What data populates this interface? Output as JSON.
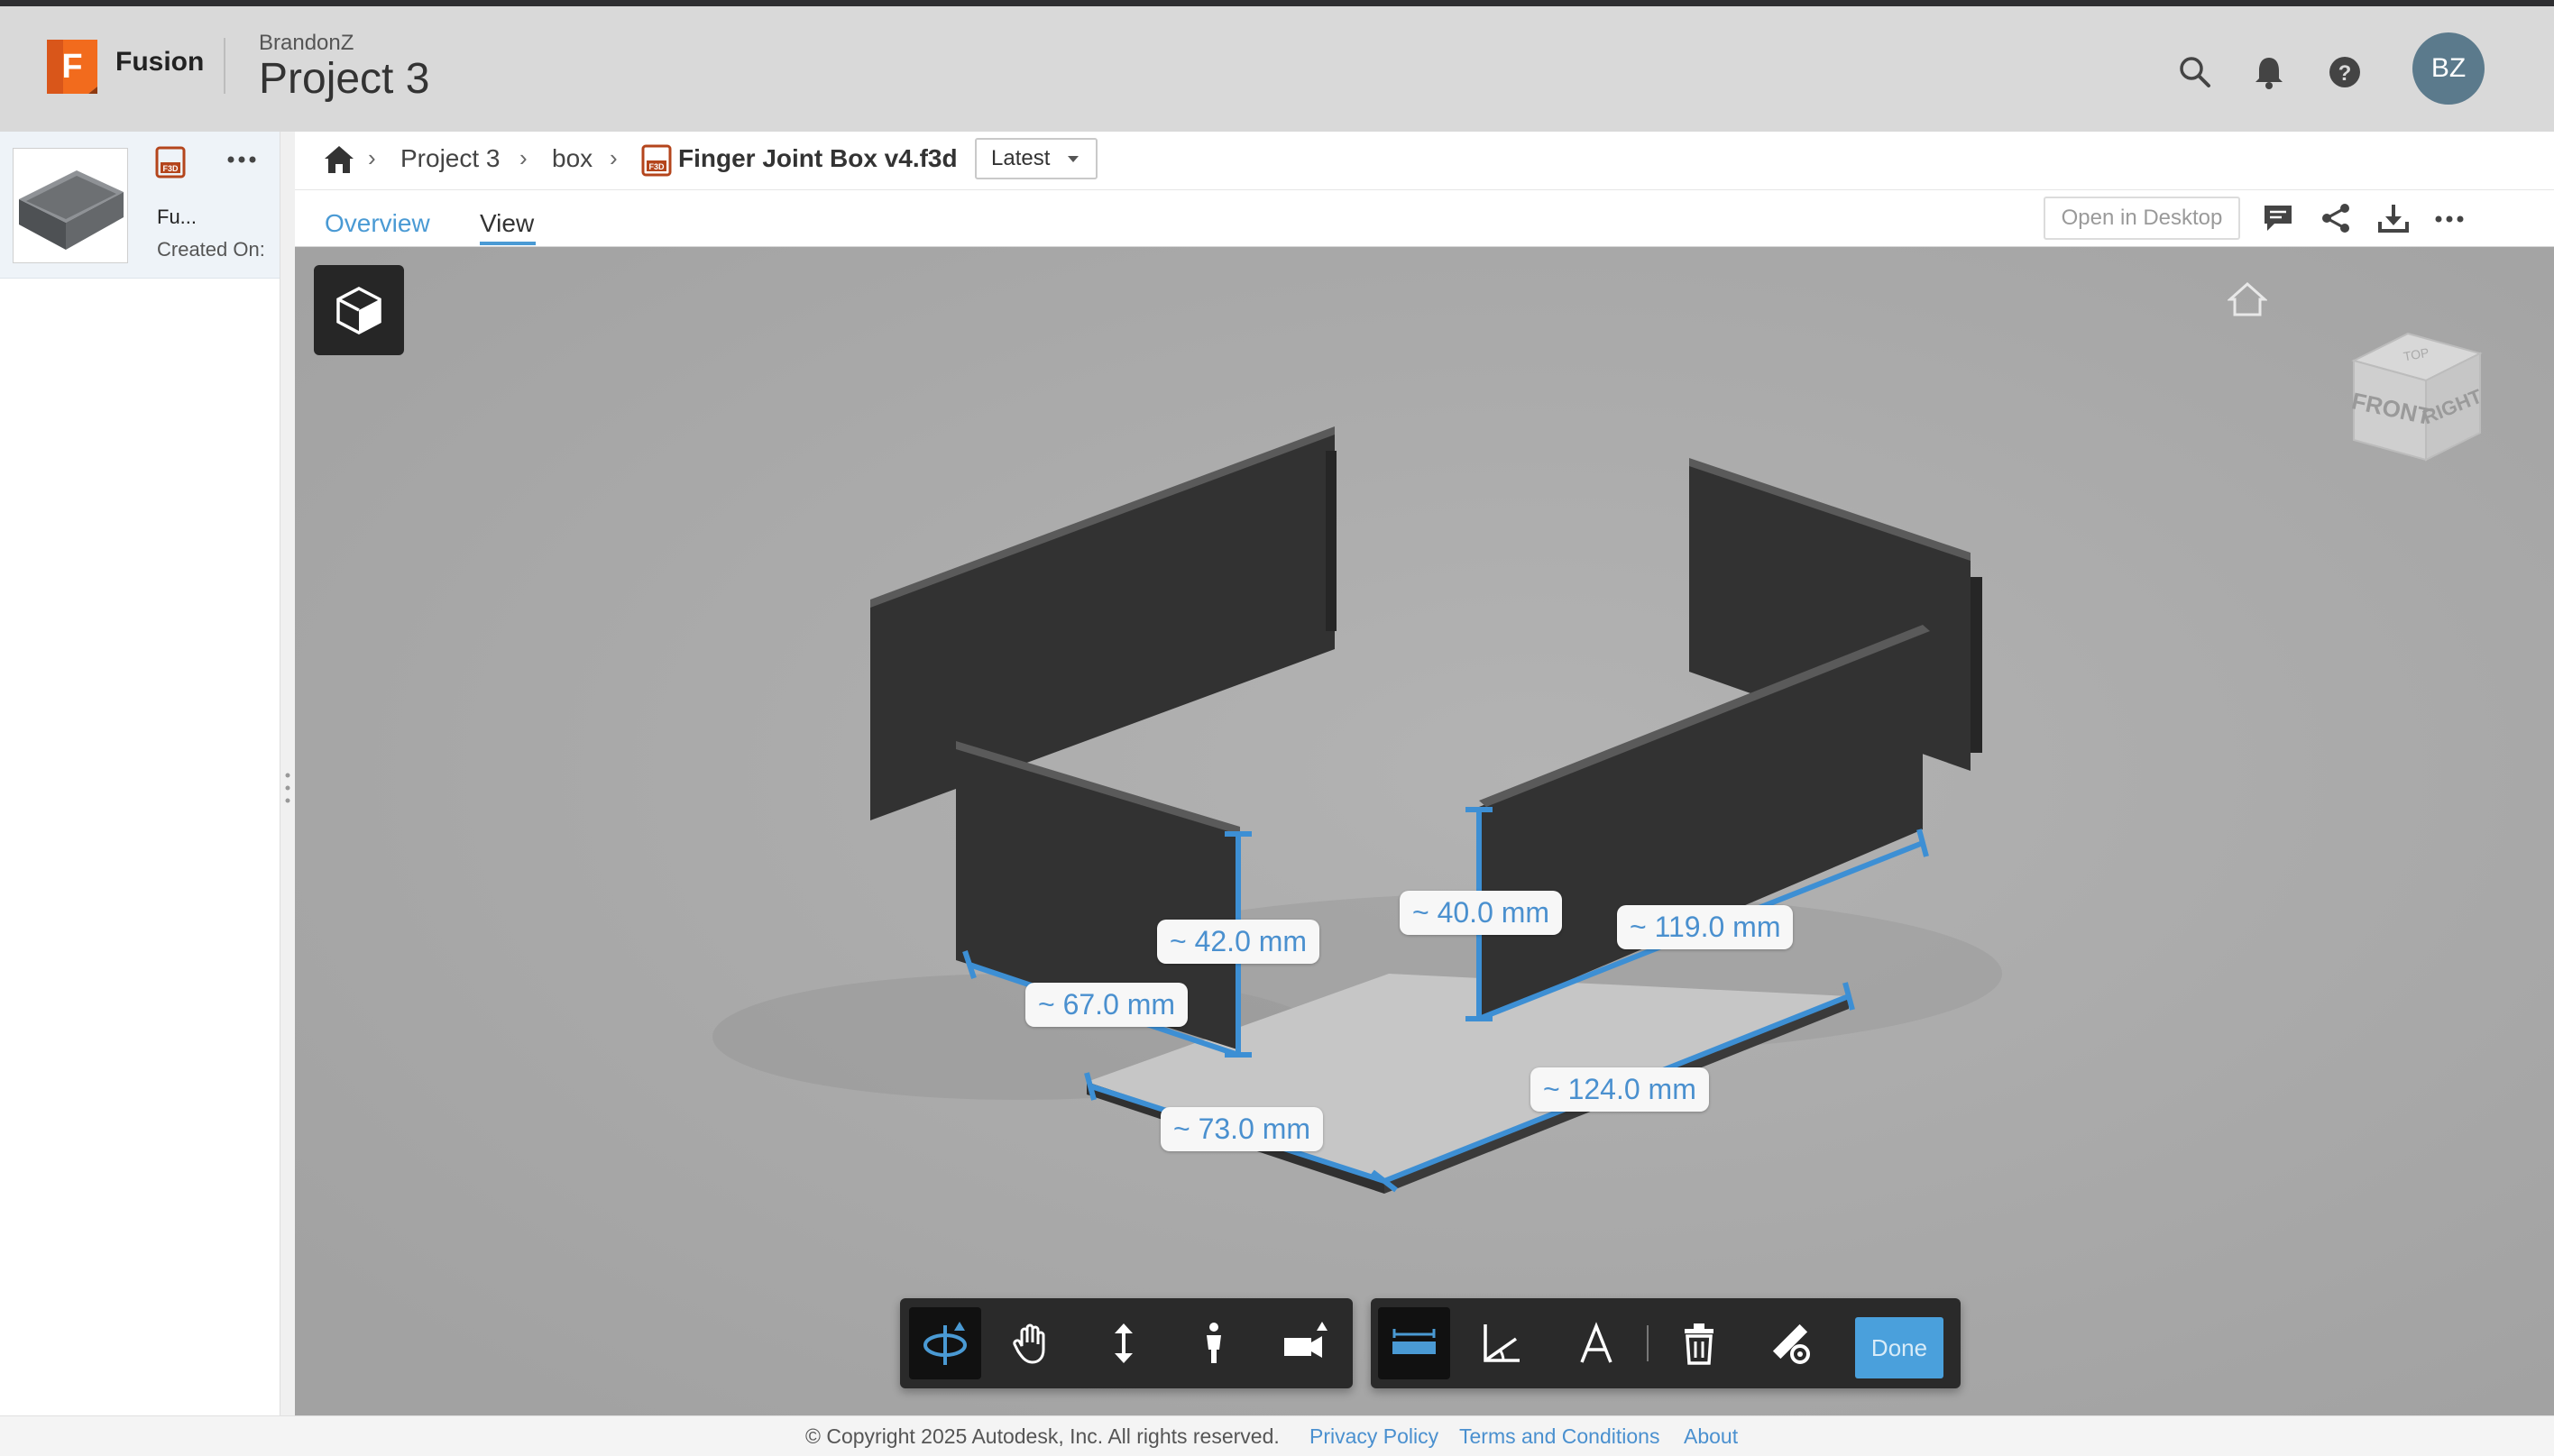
{
  "header": {
    "app_name": "Fusion",
    "logo_letter": "F",
    "owner": "BrandonZ",
    "project_title": "Project 3",
    "avatar_initials": "BZ",
    "icons": [
      "search-icon",
      "bell-icon",
      "help-icon"
    ]
  },
  "left_panel": {
    "file_badge": "F3D",
    "file_name": "Fu...",
    "created_label": "Created On:"
  },
  "breadcrumb": {
    "items": [
      "Project 3",
      "box"
    ],
    "file_badge": "F3D",
    "file_name": "Finger Joint Box v4.f3d",
    "version": "Latest"
  },
  "tabs": [
    {
      "label": "Overview",
      "active": false
    },
    {
      "label": "View",
      "active": true
    }
  ],
  "actions": {
    "open_desktop": "Open in Desktop",
    "icons": [
      "comment-icon",
      "share-icon",
      "download-icon",
      "more-icon"
    ]
  },
  "viewcube": {
    "top": "TOP",
    "front": "FRONT",
    "right": "RIGHT"
  },
  "measurements": [
    "~ 42.0 mm",
    "~ 40.0 mm",
    "~ 119.0 mm",
    "~ 67.0 mm",
    "~ 124.0 mm",
    "~ 73.0 mm"
  ],
  "toolbar": {
    "navigation": [
      "orbit-icon",
      "pan-icon",
      "zoom-icon",
      "walk-icon",
      "camera-icon"
    ],
    "measure": [
      "measure-distance-icon",
      "measure-angle-icon",
      "measure-area-icon",
      "delete-icon",
      "measure-settings-icon"
    ],
    "done_label": "Done"
  },
  "footer": {
    "copyright": "© Copyright 2025 Autodesk, Inc. All rights reserved.",
    "links": [
      "Privacy Policy",
      "Terms and Conditions",
      "About"
    ]
  },
  "colors": {
    "accent": "#4a9ad4",
    "brand": "#f26b1d",
    "viewer_bg": "#a8a8a8",
    "panel_dark": "#2f2f2f"
  }
}
